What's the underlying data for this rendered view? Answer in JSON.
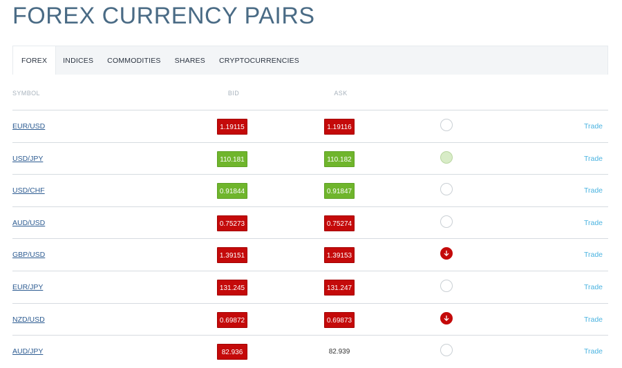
{
  "page": {
    "title": "FOREX CURRENCY PAIRS"
  },
  "tabs": [
    {
      "label": "FOREX",
      "active": true
    },
    {
      "label": "INDICES"
    },
    {
      "label": "COMMODITIES"
    },
    {
      "label": "SHARES"
    },
    {
      "label": "CRYPTOCURRENCIES"
    }
  ],
  "table": {
    "headers": {
      "symbol": "SYMBOL",
      "bid": "BID",
      "ask": "ASK"
    },
    "trade_label": "Trade",
    "rows": [
      {
        "symbol": "EUR/USD",
        "bid": "1.19115",
        "bid_color": "red",
        "ask": "1.19116",
        "ask_color": "red",
        "indicator": "neutral"
      },
      {
        "symbol": "USD/JPY",
        "bid": "110.181",
        "bid_color": "green",
        "ask": "110.182",
        "ask_color": "green",
        "indicator": "pale-green"
      },
      {
        "symbol": "USD/CHF",
        "bid": "0.91844",
        "bid_color": "green",
        "ask": "0.91847",
        "ask_color": "green",
        "indicator": "neutral"
      },
      {
        "symbol": "AUD/USD",
        "bid": "0.75273",
        "bid_color": "red",
        "ask": "0.75274",
        "ask_color": "red",
        "indicator": "neutral"
      },
      {
        "symbol": "GBP/USD",
        "bid": "1.39151",
        "bid_color": "red",
        "ask": "1.39153",
        "ask_color": "red",
        "indicator": "down"
      },
      {
        "symbol": "EUR/JPY",
        "bid": "131.245",
        "bid_color": "red",
        "ask": "131.247",
        "ask_color": "red",
        "indicator": "neutral"
      },
      {
        "symbol": "NZD/USD",
        "bid": "0.69872",
        "bid_color": "red",
        "ask": "0.69873",
        "ask_color": "red",
        "indicator": "down"
      },
      {
        "symbol": "AUD/JPY",
        "bid": "82.936",
        "bid_color": "red",
        "ask": "82.939",
        "ask_color": "plain",
        "indicator": "neutral"
      }
    ]
  },
  "colors": {
    "title": "#4a6b85",
    "price_down": "#c40a0a",
    "price_up": "#6fb52c",
    "link": "#2c5b91",
    "trade": "#4ab3e0"
  }
}
